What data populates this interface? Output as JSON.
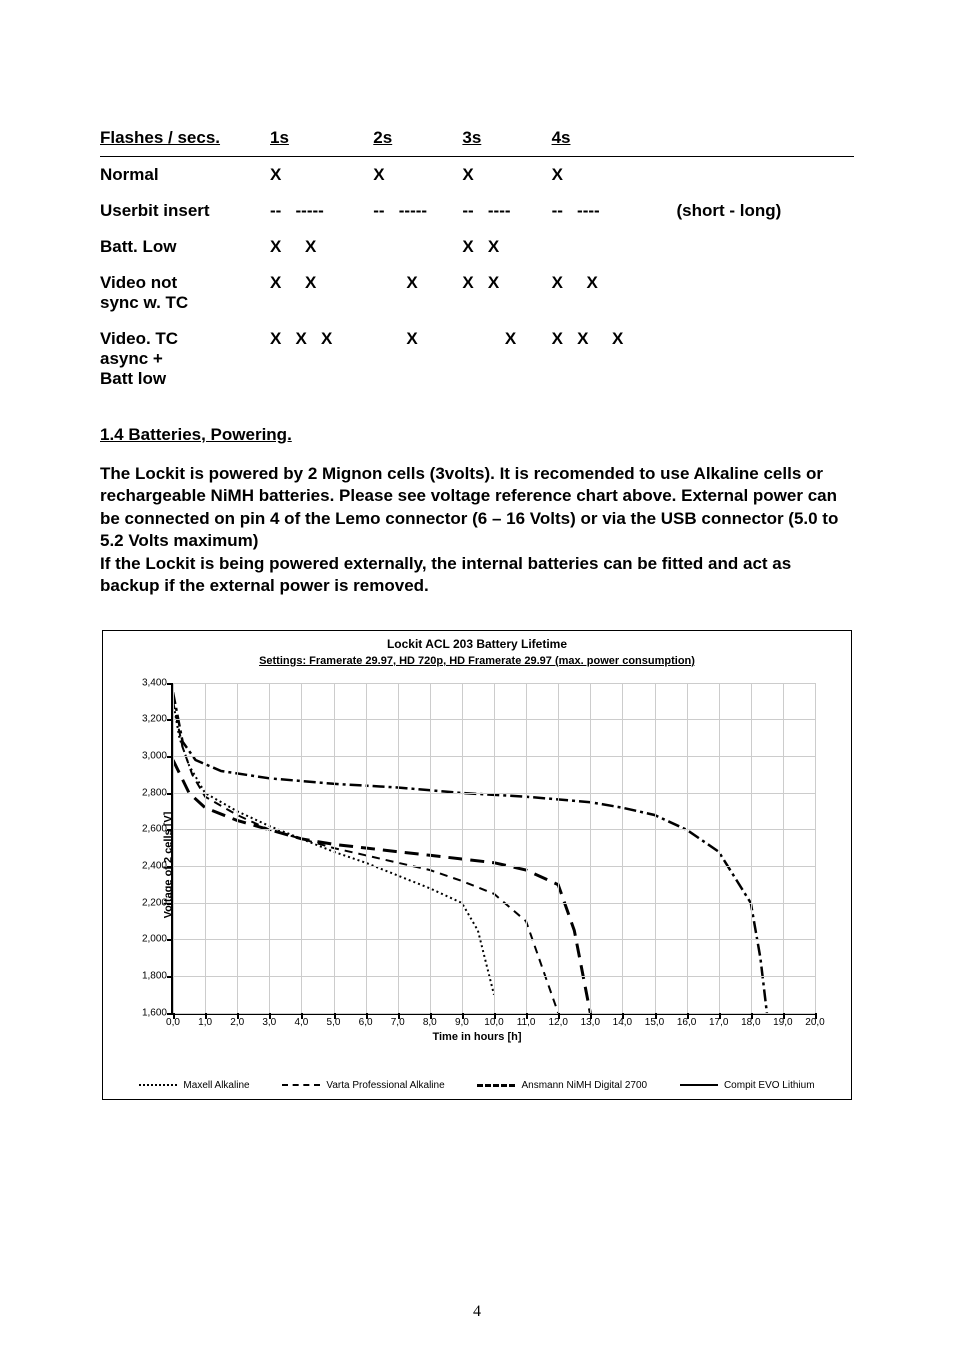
{
  "flash_table": {
    "header": [
      "Flashes / secs.",
      "1s",
      "2s",
      "3s",
      "4s"
    ],
    "rows": [
      {
        "label": "Normal",
        "c1": "X",
        "c2": "X",
        "c3": "X",
        "c4": "X",
        "extra": ""
      },
      {
        "label": "Userbit insert",
        "c1": "--   -----",
        "c2": "--   -----",
        "c3": "--   ----",
        "c4": "--   ----",
        "extra": "(short - long)"
      },
      {
        "label": "Batt. Low",
        "c1": "X     X",
        "c2": "",
        "c3": "X   X",
        "c4": "",
        "extra": ""
      },
      {
        "label": "Video not\nsync w. TC",
        "c1": "X     X",
        "c2": "       X",
        "c3": "X   X",
        "c4": "X     X",
        "extra": ""
      },
      {
        "label": "Video. TC\nasync +\nBatt low",
        "c1": "X   X   X",
        "c2": "       X",
        "c3": "         X",
        "c4": "X   X     X",
        "extra": ""
      }
    ]
  },
  "section_heading": "1.4 Batteries, Powering.",
  "body_text": "The Lockit is powered by 2 Mignon cells (3volts). It is recomended to use Alkaline cells or rechargeable NiMH batteries. Please see voltage reference chart above. External power can be connected on pin 4 of the Lemo connector (6 – 16 Volts) or via the USB connector (5.0 to 5.2 Volts maximum)\nIf the Lockit is being powered externally, the internal batteries can be fitted and act as backup if the external power is removed.",
  "page_number": "4",
  "chart_data": {
    "type": "line",
    "title": "Lockit ACL 203 Battery Lifetime",
    "subtitle": "Settings: Framerate 29.97, HD 720p, HD Framerate 29.97 (max. power consumption)",
    "xlabel": "Time in hours [h]",
    "ylabel": "Voltage of 2 cells [V]",
    "xlim": [
      0.0,
      20.0
    ],
    "ylim": [
      1.6,
      3.4
    ],
    "xticks": [
      "0,0",
      "1,0",
      "2,0",
      "3,0",
      "4,0",
      "5,0",
      "6,0",
      "7,0",
      "8,0",
      "9,0",
      "10,0",
      "11,0",
      "12,0",
      "13,0",
      "14,0",
      "15,0",
      "16,0",
      "17,0",
      "18,0",
      "19,0",
      "20,0"
    ],
    "yticks": [
      "1,600",
      "1,800",
      "2,000",
      "2,200",
      "2,400",
      "2,600",
      "2,800",
      "3,000",
      "3,200",
      "3,400"
    ],
    "series": [
      {
        "name": "Maxell Alkaline",
        "style": "dot",
        "points": [
          [
            0.0,
            3.3
          ],
          [
            0.2,
            3.1
          ],
          [
            0.5,
            2.95
          ],
          [
            1.0,
            2.8
          ],
          [
            2.0,
            2.7
          ],
          [
            3.0,
            2.62
          ],
          [
            4.0,
            2.55
          ],
          [
            5.0,
            2.48
          ],
          [
            6.0,
            2.42
          ],
          [
            7.0,
            2.35
          ],
          [
            8.0,
            2.28
          ],
          [
            9.0,
            2.2
          ],
          [
            9.5,
            2.05
          ],
          [
            10.0,
            1.7
          ]
        ]
      },
      {
        "name": "Varta Professional Alkaline",
        "style": "dash",
        "points": [
          [
            0.0,
            3.3
          ],
          [
            0.3,
            3.05
          ],
          [
            0.6,
            2.9
          ],
          [
            1.0,
            2.78
          ],
          [
            2.0,
            2.68
          ],
          [
            3.0,
            2.6
          ],
          [
            4.0,
            2.55
          ],
          [
            5.0,
            2.5
          ],
          [
            6.0,
            2.46
          ],
          [
            7.0,
            2.42
          ],
          [
            8.0,
            2.38
          ],
          [
            9.0,
            2.32
          ],
          [
            10.0,
            2.25
          ],
          [
            11.0,
            2.1
          ],
          [
            11.5,
            1.85
          ],
          [
            12.0,
            1.6
          ]
        ]
      },
      {
        "name": "Ansmann NiMH Digital 2700",
        "style": "ldash",
        "points": [
          [
            0.0,
            2.98
          ],
          [
            0.5,
            2.8
          ],
          [
            1.0,
            2.72
          ],
          [
            2.0,
            2.65
          ],
          [
            3.0,
            2.6
          ],
          [
            4.0,
            2.55
          ],
          [
            5.0,
            2.52
          ],
          [
            6.0,
            2.5
          ],
          [
            7.0,
            2.48
          ],
          [
            8.0,
            2.46
          ],
          [
            9.0,
            2.44
          ],
          [
            10.0,
            2.42
          ],
          [
            11.0,
            2.38
          ],
          [
            12.0,
            2.3
          ],
          [
            12.5,
            2.05
          ],
          [
            13.0,
            1.6
          ]
        ]
      },
      {
        "name": "Compit EVO Lithium",
        "style": "ddot",
        "points": [
          [
            0.0,
            3.35
          ],
          [
            0.3,
            3.08
          ],
          [
            0.7,
            2.98
          ],
          [
            1.5,
            2.92
          ],
          [
            3.0,
            2.88
          ],
          [
            5.0,
            2.85
          ],
          [
            7.0,
            2.83
          ],
          [
            9.0,
            2.8
          ],
          [
            11.0,
            2.78
          ],
          [
            13.0,
            2.75
          ],
          [
            14.0,
            2.72
          ],
          [
            15.0,
            2.68
          ],
          [
            16.0,
            2.6
          ],
          [
            17.0,
            2.48
          ],
          [
            18.0,
            2.2
          ],
          [
            18.3,
            1.9
          ],
          [
            18.5,
            1.6
          ]
        ]
      }
    ],
    "legend": [
      "Maxell Alkaline",
      "Varta Professional Alkaline",
      "Ansmann NiMH Digital 2700",
      "Compit EVO Lithium"
    ]
  }
}
